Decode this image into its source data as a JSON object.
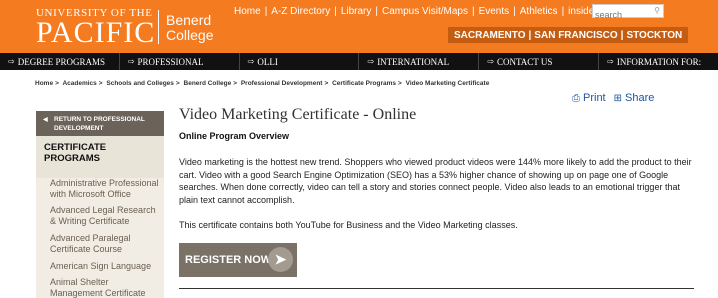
{
  "header": {
    "logo_top": "UNIVERSITY OF THE",
    "logo_main": "PACIFIC",
    "college_line1": "Benerd",
    "college_line2": "College",
    "links": [
      "Home",
      "A-Z Directory",
      "Library",
      "Campus Visit/Maps",
      "Events",
      "Athletics",
      "insidePacific"
    ],
    "search_placeholder": "search",
    "campuses": [
      "SACRAMENTO",
      "SAN FRANCISCO",
      "STOCKTON"
    ]
  },
  "nav": {
    "items": [
      "DEGREE PROGRAMS",
      "PROFESSIONAL",
      "OLLI",
      "INTERNATIONAL",
      "CONTACT US",
      "INFORMATION FOR:"
    ]
  },
  "breadcrumb": [
    "Home",
    "Academics",
    "Schools and Colleges",
    "Benerd College",
    "Professional Development",
    "Certificate Programs",
    "Video Marketing Certificate"
  ],
  "tools": {
    "print": "Print",
    "share": "Share"
  },
  "sidebar": {
    "return_line1": "RETURN TO PROFESSIONAL",
    "return_line2": "DEVELOPMENT",
    "heading_line1": "CERTIFICATE",
    "heading_line2": "PROGRAMS",
    "links": [
      [
        "Administrative Professional",
        "with Microsoft Office"
      ],
      [
        "Advanced Legal Research",
        "& Writing Certificate"
      ],
      [
        "Advanced Paralegal",
        "Certificate Course"
      ],
      [
        "American Sign Language"
      ],
      [
        "Animal Shelter",
        "Management Certificate"
      ]
    ]
  },
  "main": {
    "title": "Video Marketing Certificate - Online",
    "subheading": "Online Program Overview",
    "paragraph1": "Video marketing is the hottest new trend. Shoppers who viewed product videos were 144% more likely to add the product to their cart. Video with a good Search Engine Optimization (SEO) has a 53% higher chance of showing up on page one of Google searches. When done correctly, video can tell a story and stories connect people. Video also leads to an emotional trigger that plain text cannot accomplish.",
    "paragraph2": "This certificate contains both YouTube for Business and the Video Marketing classes.",
    "register_label": "REGISTER NOW"
  },
  "colors": {
    "header_orange": "#f47b20",
    "campus_bar": "#c45d12",
    "nav_black": "#111111",
    "link_blue": "#1e56a0",
    "sidebar_bg": "#f1ede4",
    "button_gray": "#7a7167"
  }
}
